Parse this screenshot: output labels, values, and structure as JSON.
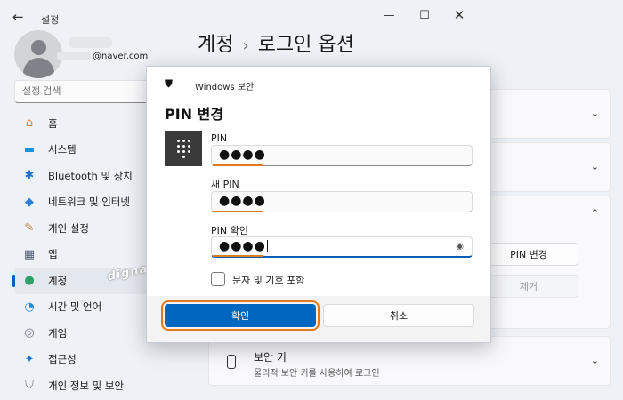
{
  "window": {
    "back_glyph": "←",
    "title": "설정",
    "minimize_glyph": "—",
    "maximize_glyph": "☐",
    "close_glyph": "✕"
  },
  "user": {
    "email_suffix": "@naver.com"
  },
  "search": {
    "placeholder": "설정 검색"
  },
  "sidebar": {
    "items": [
      {
        "label": "홈",
        "icon": "home-icon",
        "glyph": "⌂",
        "color": "#d9822b"
      },
      {
        "label": "시스템",
        "icon": "monitor-icon",
        "glyph": "▬",
        "color": "#1e90d6"
      },
      {
        "label": "Bluetooth 및 장치",
        "icon": "bluetooth-icon",
        "glyph": "✱",
        "color": "#1e70c8"
      },
      {
        "label": "네트워크 및 인터넷",
        "icon": "wifi-icon",
        "glyph": "◆",
        "color": "#2a7fd4"
      },
      {
        "label": "개인 설정",
        "icon": "brush-icon",
        "glyph": "✎",
        "color": "#c7833e"
      },
      {
        "label": "앱",
        "icon": "apps-icon",
        "glyph": "▦",
        "color": "#4f5d73"
      },
      {
        "label": "계정",
        "icon": "account-icon",
        "glyph": "●",
        "color": "#2ca06a",
        "active": true
      },
      {
        "label": "시간 및 언어",
        "icon": "globe-clock-icon",
        "glyph": "◔",
        "color": "#2a86c9"
      },
      {
        "label": "게임",
        "icon": "gamepad-icon",
        "glyph": "◎",
        "color": "#6f7785"
      },
      {
        "label": "접근성",
        "icon": "accessibility-icon",
        "glyph": "✦",
        "color": "#1c73c4"
      },
      {
        "label": "개인 정보 및 보안",
        "icon": "shield-icon",
        "glyph": "⛉",
        "color": "#6f7785"
      }
    ]
  },
  "breadcrumb": {
    "parent": "계정",
    "separator": "›",
    "current": "로그인 옵션"
  },
  "right_panel": {
    "chevron_down": "⌄",
    "chevron_up": "⌃",
    "pin_change_label": "PIN 변경",
    "remove_label": "제거",
    "security_key_title": "보안 키",
    "security_key_subtitle": "물리적 보안 키를 사용하여 로그인"
  },
  "watermark": "dignanine",
  "dialog": {
    "app_name": "Windows 보안",
    "title": "PIN 변경",
    "fields": {
      "current_pin": {
        "label": "PIN",
        "value": "●●●●"
      },
      "new_pin": {
        "label": "새 PIN",
        "value": "●●●●"
      },
      "confirm_pin": {
        "label": "PIN 확인",
        "value": "●●●●"
      }
    },
    "checkbox_label": "문자 및 기호 포함",
    "ok_label": "확인",
    "cancel_label": "취소"
  },
  "colors": {
    "accent": "#0067c0",
    "highlight": "#e07a1f"
  }
}
